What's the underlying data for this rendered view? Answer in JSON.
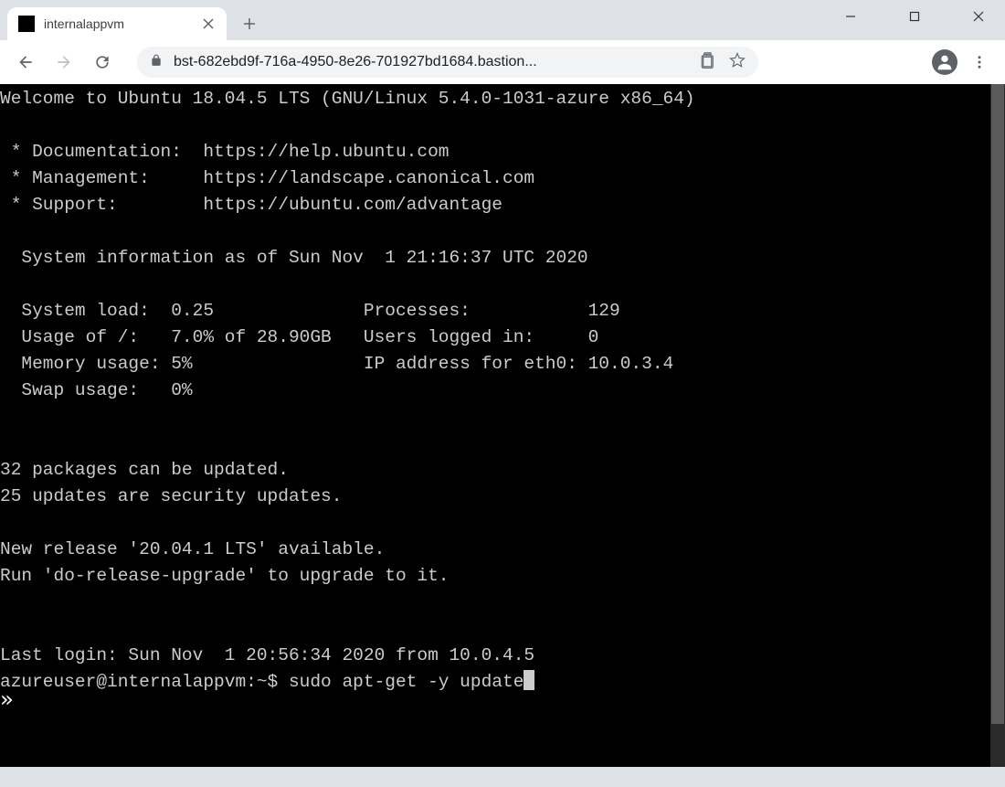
{
  "window": {
    "tab_title": "internalappvm",
    "url_display": "bst-682ebd9f-716a-4950-8e26-701927bd1684.bastion..."
  },
  "terminal": {
    "welcome": "Welcome to Ubuntu 18.04.5 LTS (GNU/Linux 5.4.0-1031-azure x86_64)",
    "doc_line": " * Documentation:  https://help.ubuntu.com",
    "mgmt_line": " * Management:     https://landscape.canonical.com",
    "support_line": " * Support:        https://ubuntu.com/advantage",
    "sysinfo_header": "  System information as of Sun Nov  1 21:16:37 UTC 2020",
    "row1": "  System load:  0.25              Processes:           129",
    "row2": "  Usage of /:   7.0% of 28.90GB   Users logged in:     0",
    "row3": "  Memory usage: 5%                IP address for eth0: 10.0.3.4",
    "row4": "  Swap usage:   0%",
    "pkg1": "32 packages can be updated.",
    "pkg2": "25 updates are security updates.",
    "rel1": "New release '20.04.1 LTS' available.",
    "rel2": "Run 'do-release-upgrade' to upgrade to it.",
    "last_login": "Last login: Sun Nov  1 20:56:34 2020 from 10.0.4.5",
    "prompt": "azureuser@internalappvm:~$ sudo apt-get -y update",
    "chevrons": "»"
  }
}
